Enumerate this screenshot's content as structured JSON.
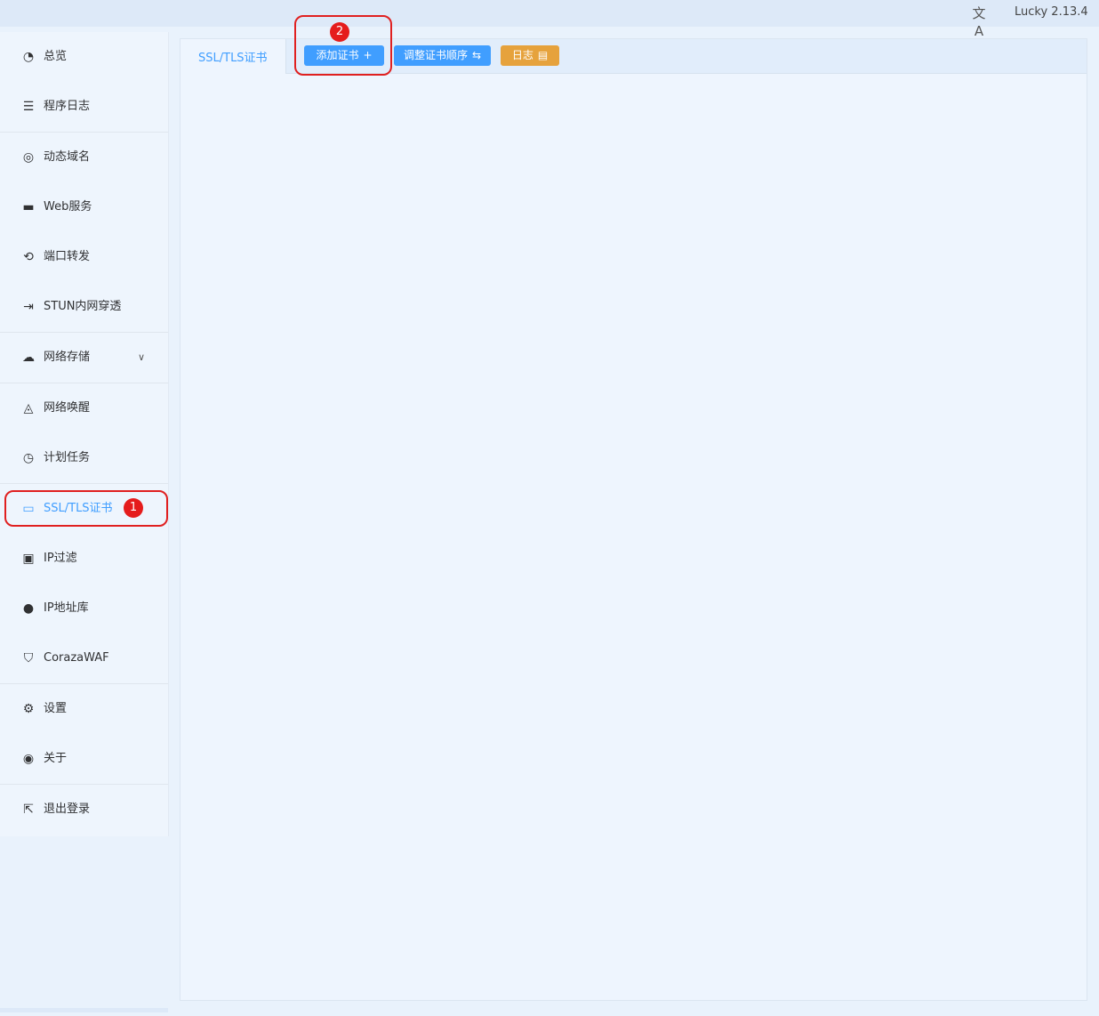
{
  "header": {
    "lang_icon": "translate-icon",
    "version": "Lucky 2.13.4"
  },
  "sidebar": {
    "items": [
      {
        "name": "overview",
        "label": "总览",
        "icon": "dashboard-icon",
        "glyph": "◔"
      },
      {
        "name": "program-log",
        "label": "程序日志",
        "icon": "log-icon",
        "glyph": "☰"
      },
      {
        "name": "ddns",
        "label": "动态域名",
        "icon": "dns-icon",
        "glyph": "◎"
      },
      {
        "name": "web-service",
        "label": "Web服务",
        "icon": "web-icon",
        "glyph": "▬"
      },
      {
        "name": "port-forward",
        "label": "端口转发",
        "icon": "forward-icon",
        "glyph": "⟲"
      },
      {
        "name": "stun",
        "label": "STUN内网穿透",
        "icon": "stun-icon",
        "glyph": "⇥"
      },
      {
        "name": "net-storage",
        "label": "网络存储",
        "icon": "cloud-icon",
        "glyph": "☁",
        "expand_icon": "chevron-down-icon"
      },
      {
        "name": "wol",
        "label": "网络唤醒",
        "icon": "bell-icon",
        "glyph": "◬"
      },
      {
        "name": "cron",
        "label": "计划任务",
        "icon": "clock-icon",
        "glyph": "◷"
      },
      {
        "name": "ssl",
        "label": "SSL/TLS证书",
        "icon": "certificate-icon",
        "glyph": "▭",
        "active": true
      },
      {
        "name": "ip-filter",
        "label": "IP过滤",
        "icon": "ip-filter-icon",
        "glyph": "▣"
      },
      {
        "name": "ip-db",
        "label": "IP地址库",
        "icon": "location-icon",
        "glyph": "●"
      },
      {
        "name": "waf",
        "label": "CorazaWAF",
        "icon": "shield-icon",
        "glyph": "⛉"
      },
      {
        "name": "settings",
        "label": "设置",
        "icon": "gear-icon",
        "glyph": "⚙"
      },
      {
        "name": "about",
        "label": "关于",
        "icon": "info-icon",
        "glyph": "◉"
      },
      {
        "name": "logout",
        "label": "退出登录",
        "icon": "logout-icon",
        "glyph": "⇱"
      }
    ]
  },
  "main": {
    "tab_label": "SSL/TLS证书",
    "buttons": {
      "add": {
        "label": "添加证书",
        "icon": "plus-icon",
        "glyph": "+"
      },
      "order": {
        "label": "调整证书顺序",
        "icon": "sort-icon",
        "glyph": "⇆"
      },
      "log": {
        "label": "日志",
        "icon": "document-icon",
        "glyph": "▤"
      }
    }
  },
  "annotations": [
    {
      "number": "1"
    },
    {
      "number": "2"
    }
  ],
  "colors": {
    "primary": "#409eff",
    "warning": "#e6a23c",
    "annotation": "#e02020"
  }
}
